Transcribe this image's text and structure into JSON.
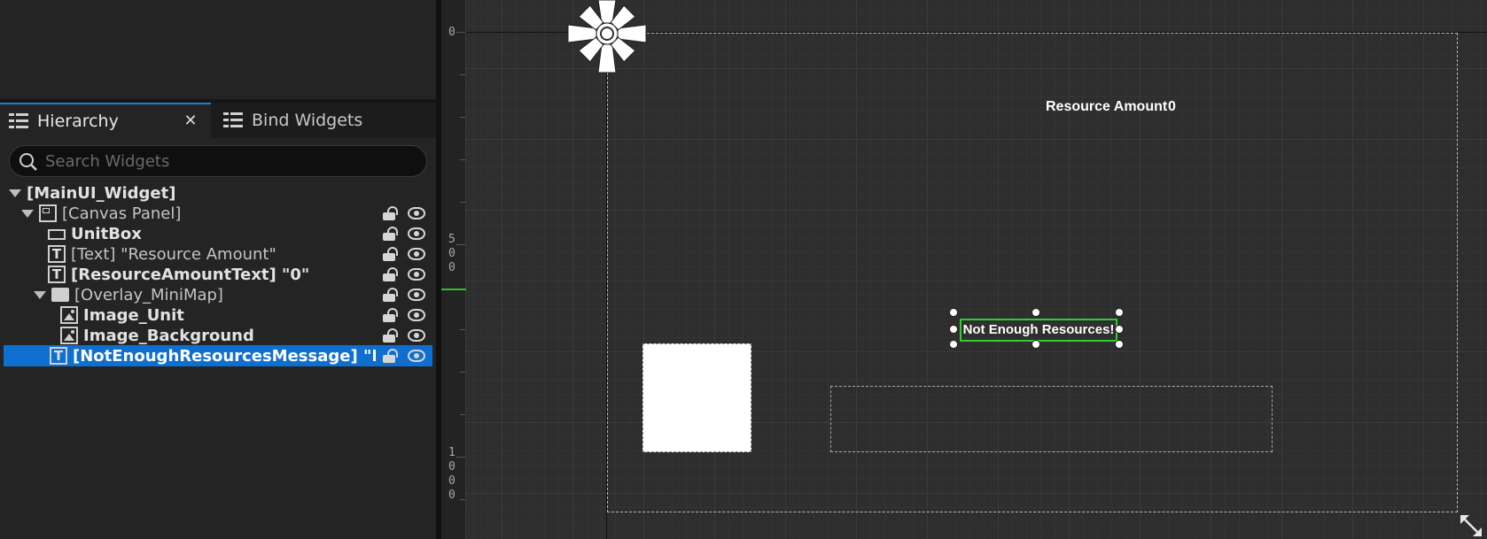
{
  "tabs": {
    "hierarchy": "Hierarchy",
    "bind_widgets": "Bind Widgets",
    "close_symbol": "✕"
  },
  "search": {
    "placeholder": "Search Widgets"
  },
  "tree": [
    {
      "label": "[MainUI_Widget]",
      "bold": true,
      "icon": "none",
      "expander": true
    },
    {
      "label": "[Canvas Panel]",
      "bold": false,
      "icon": "canvas-panel-icon",
      "expander": true
    },
    {
      "label": "UnitBox",
      "bold": true,
      "icon": "box-icon"
    },
    {
      "label": "[Text] \"Resource Amount\"",
      "bold": false,
      "icon": "text-icon"
    },
    {
      "label": "[ResourceAmountText] \"0\"",
      "bold": true,
      "icon": "text-icon"
    },
    {
      "label": "[Overlay_MiniMap]",
      "bold": false,
      "icon": "overlay-icon",
      "expander": true
    },
    {
      "label": "Image_Unit",
      "bold": true,
      "icon": "image-icon"
    },
    {
      "label": "Image_Background",
      "bold": true,
      "icon": "image-icon"
    },
    {
      "label": "[NotEnoughResourcesMessage] \"Not Er",
      "bold": true,
      "icon": "text-icon",
      "selected": true
    }
  ],
  "ruler": {
    "labels": [
      "0",
      "5",
      "0",
      "0",
      "1",
      "0",
      "0",
      "0"
    ]
  },
  "canvas": {
    "resource_label": "Resource Amount",
    "resource_value": "0",
    "message_text": "Not Enough Resources!"
  },
  "colors": {
    "selection": "#0e6fd0",
    "selected_outline": "#2fcf2f",
    "tab_accent": "#1f7fd6"
  }
}
